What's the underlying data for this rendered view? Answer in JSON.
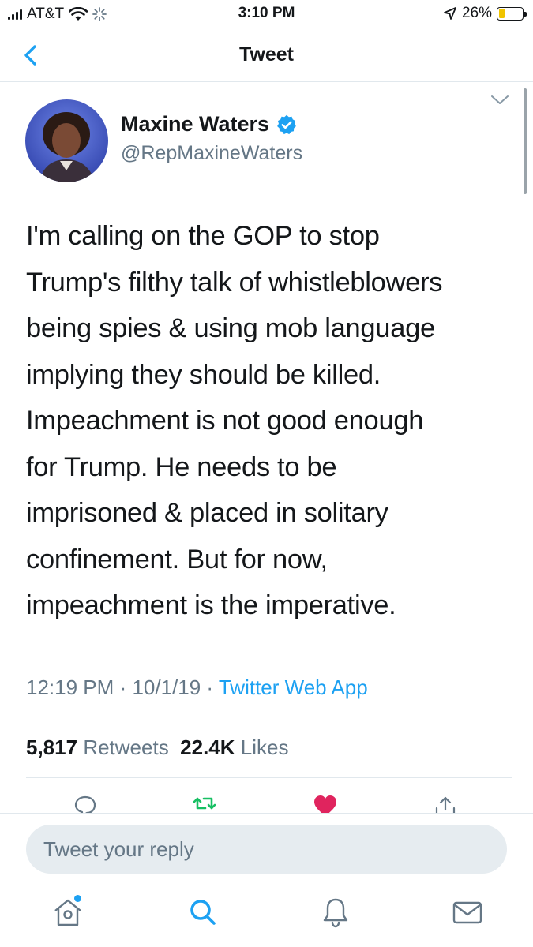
{
  "status_bar": {
    "carrier": "AT&T",
    "time": "3:10 PM",
    "battery": "26%",
    "battery_level": 0.26
  },
  "nav": {
    "title": "Tweet",
    "back_icon": "chevron-left-icon"
  },
  "tweet": {
    "author_name": "Maxine Waters",
    "author_handle": "@RepMaxineWaters",
    "verified": true,
    "text": "I'm calling on the GOP to stop\nTrump's filthy talk of whistleblowers\nbeing spies & using mob language\nimplying they should be killed.\nImpeachment is not good enough\nfor Trump. He needs to be\nimprisoned & placed in solitary\nconfinement. But for now,\nimpeachment is the imperative.",
    "time": "12:19 PM",
    "date": "10/1/19",
    "separator": "·",
    "source": "Twitter Web App",
    "retweets_count": "5,817",
    "retweets_label": "Retweets",
    "likes_count": "22.4K",
    "likes_label": "Likes"
  },
  "reply": {
    "placeholder": "Tweet your reply"
  },
  "colors": {
    "accent": "#1da1f2",
    "retweet": "#17bf63",
    "like": "#e0245e",
    "secondary_text": "#657786"
  },
  "tabs": [
    "home-icon",
    "search-icon",
    "notifications-icon",
    "messages-icon"
  ]
}
